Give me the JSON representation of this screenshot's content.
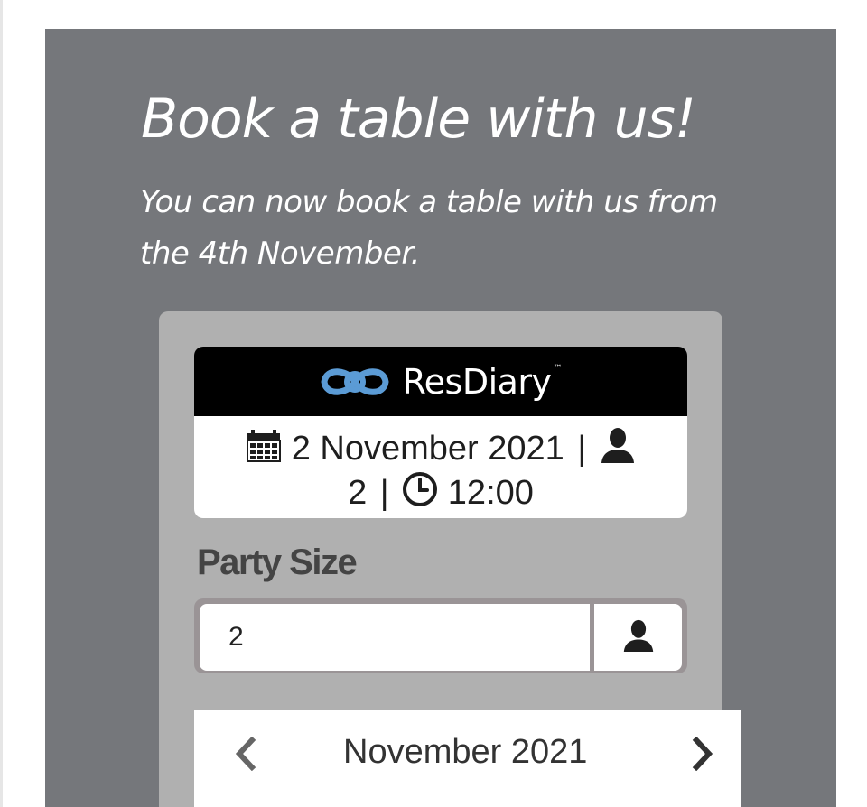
{
  "promo": {
    "heading": "Book a table with us!",
    "subheading": "You can now book a table with us from the 4th November."
  },
  "widget": {
    "brand": {
      "name": "ResDiary",
      "trademark": "™",
      "logo_color": "#5b9bd5"
    },
    "summary": {
      "date": "2 November 2021",
      "separator": "|",
      "party_size": "2",
      "time": "12:00",
      "icons": [
        "calendar-icon",
        "user-icon",
        "clock-icon"
      ]
    },
    "party_size": {
      "label": "Party Size",
      "value": "2",
      "addon_icon": "user-icon"
    },
    "calendar": {
      "month_label": "November 2021",
      "prev_icon": "chevron-left-icon",
      "next_icon": "chevron-right-icon"
    }
  },
  "colors": {
    "panel_bg": "#75777b",
    "widget_bg": "#b0b0b0",
    "brand_bar_bg": "#000000",
    "field_border": "#9a9496"
  }
}
